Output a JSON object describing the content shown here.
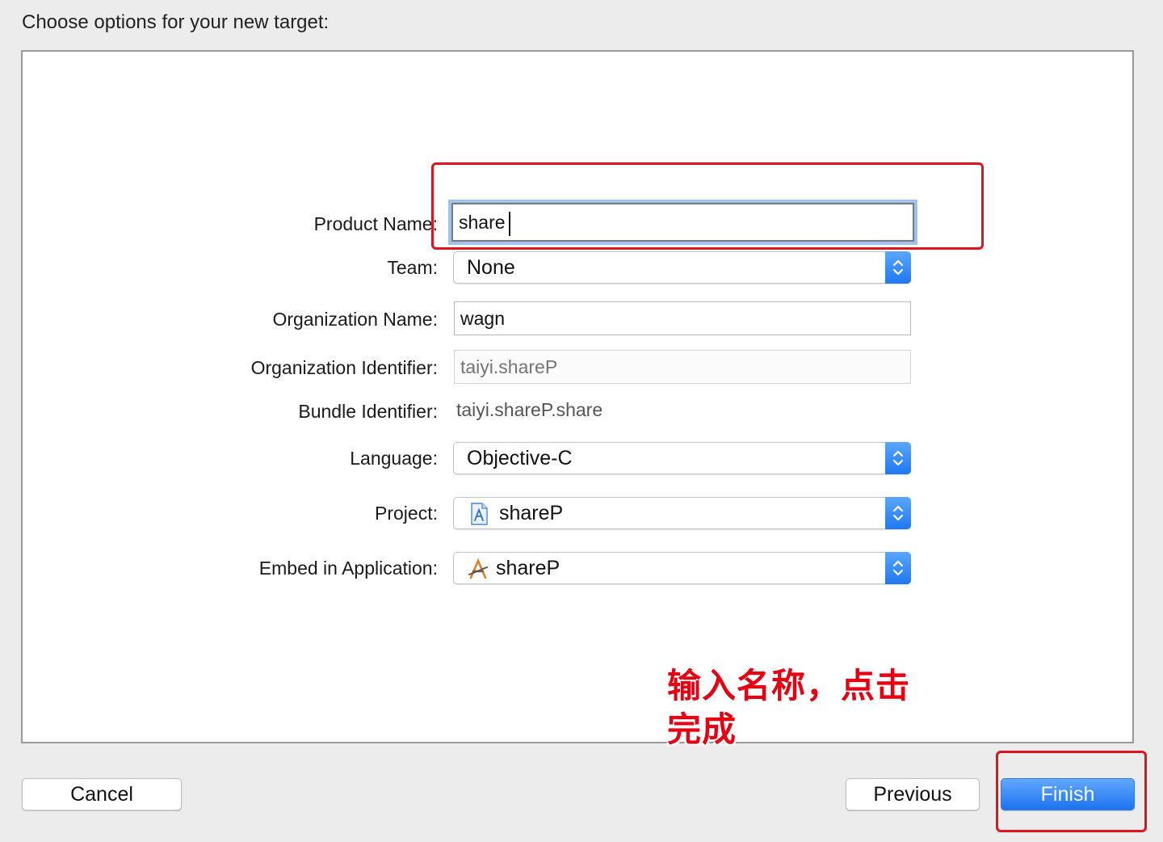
{
  "heading": "Choose options for your new target:",
  "form": {
    "product_name": {
      "label": "Product Name:",
      "value": "share"
    },
    "team": {
      "label": "Team:",
      "value": "None"
    },
    "organization_name": {
      "label": "Organization Name:",
      "value": "wagn"
    },
    "organization_identifier": {
      "label": "Organization Identifier:",
      "value": "taiyi.shareP"
    },
    "bundle_identifier": {
      "label": "Bundle Identifier:",
      "value": "taiyi.shareP.share"
    },
    "language": {
      "label": "Language:",
      "value": "Objective-C"
    },
    "project": {
      "label": "Project:",
      "value": "shareP",
      "icon": "xcode-project-icon"
    },
    "embed_in_application": {
      "label": "Embed in Application:",
      "value": "shareP",
      "icon": "app-target-icon"
    }
  },
  "annotation": {
    "line1": "输入名称，点击",
    "line2": "完成",
    "color": "#e60012"
  },
  "buttons": {
    "cancel": "Cancel",
    "previous": "Previous",
    "finish": "Finish"
  },
  "colors": {
    "accent": "#1f78f0",
    "highlight": "#e0141e"
  }
}
